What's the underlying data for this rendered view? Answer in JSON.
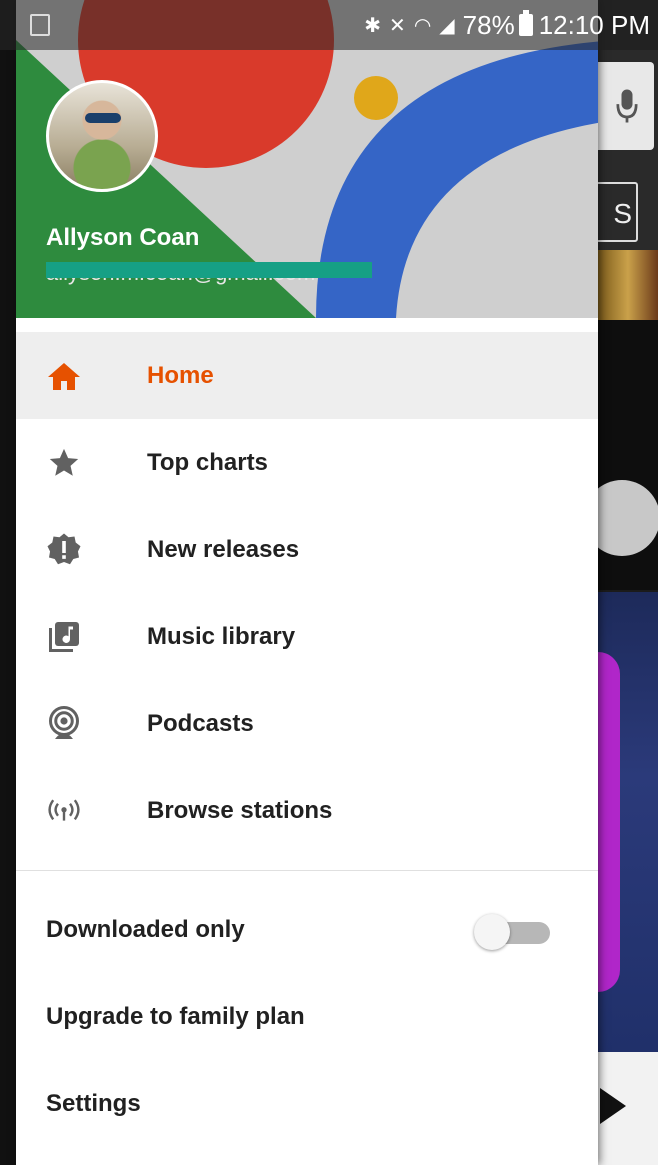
{
  "status_bar": {
    "battery": "78%",
    "time": "12:10 PM",
    "icons": [
      "screen-rotate-icon",
      "bluetooth-icon",
      "mute-icon",
      "wifi-icon",
      "4g-icon",
      "signal-icon",
      "battery-icon"
    ]
  },
  "drawer": {
    "user": {
      "name": "Allyson Coan",
      "email": "allyson.m.coan@gmail.com"
    },
    "menu": [
      {
        "label": "Home",
        "icon": "home-icon",
        "active": true
      },
      {
        "label": "Top charts",
        "icon": "star-icon",
        "active": false
      },
      {
        "label": "New releases",
        "icon": "new-releases-icon",
        "active": false
      },
      {
        "label": "Music library",
        "icon": "music-library-icon",
        "active": false
      },
      {
        "label": "Podcasts",
        "icon": "podcast-icon",
        "active": false
      },
      {
        "label": "Browse stations",
        "icon": "radio-icon",
        "active": false
      }
    ],
    "settings": [
      {
        "label": "Downloaded only",
        "toggle": false
      },
      {
        "label": "Upgrade to family plan"
      },
      {
        "label": "Settings"
      }
    ]
  },
  "background_app": {
    "button_letter": "S"
  },
  "colors": {
    "accent": "#e65100",
    "header_red": "#d93a2b",
    "header_green": "#2e8b3e",
    "header_blue": "#3565c6",
    "header_yellow": "#e0a71a"
  }
}
